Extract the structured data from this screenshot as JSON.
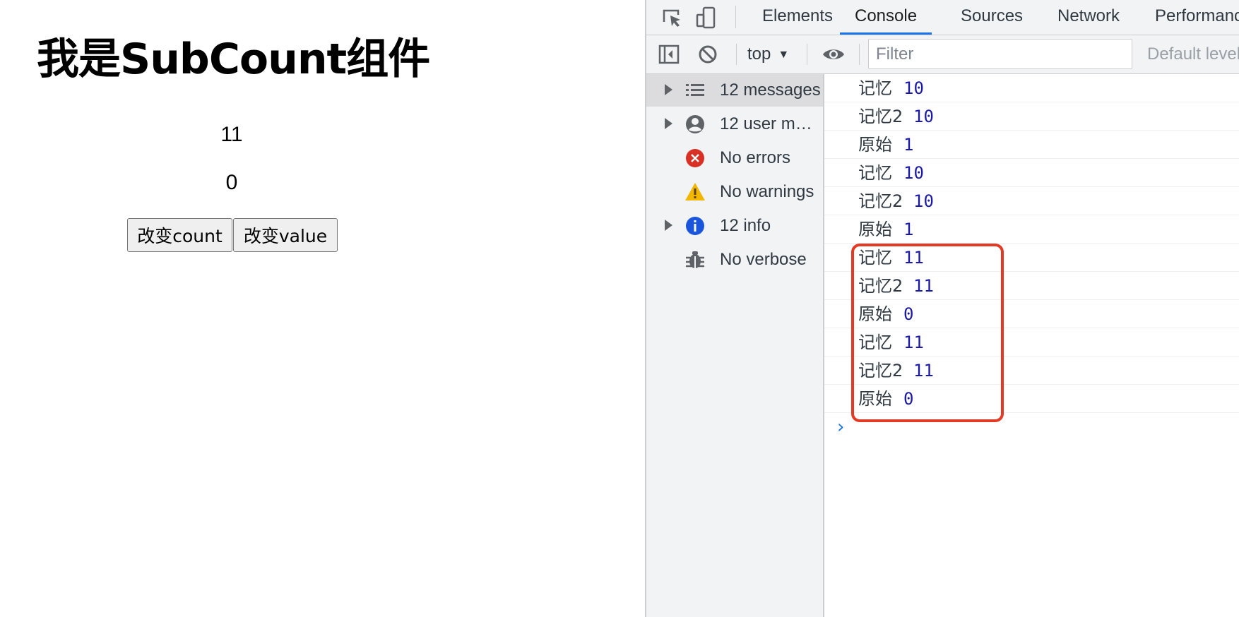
{
  "page": {
    "title": "我是SubCount组件",
    "count": "11",
    "value": "0",
    "buttons": {
      "change_count": "改变count",
      "change_value": "改变value"
    }
  },
  "devtools": {
    "tabs": [
      "Elements",
      "Console",
      "Sources",
      "Network",
      "Performanc"
    ],
    "active_tab": "Console",
    "toolbar": {
      "context": "top",
      "filter_placeholder": "Filter",
      "levels": "Default levels"
    },
    "sidebar": [
      {
        "label": "12 messages",
        "icon": "list-icon",
        "expandable": true,
        "selected": true
      },
      {
        "label": "12 user me…",
        "icon": "user-icon",
        "expandable": true,
        "selected": false
      },
      {
        "label": "No errors",
        "icon": "error-icon",
        "expandable": false,
        "selected": false
      },
      {
        "label": "No warnings",
        "icon": "warning-icon",
        "expandable": false,
        "selected": false
      },
      {
        "label": "12 info",
        "icon": "info-icon",
        "expandable": true,
        "selected": false
      },
      {
        "label": "No verbose",
        "icon": "bug-icon",
        "expandable": false,
        "selected": false
      }
    ],
    "messages": [
      {
        "label": "记忆",
        "value": "10"
      },
      {
        "label": "记忆2",
        "value": "10"
      },
      {
        "label": "原始",
        "value": "1"
      },
      {
        "label": "记忆",
        "value": "10"
      },
      {
        "label": "记忆2",
        "value": "10"
      },
      {
        "label": "原始",
        "value": "1"
      },
      {
        "label": "记忆",
        "value": "11"
      },
      {
        "label": "记忆2",
        "value": "11"
      },
      {
        "label": "原始",
        "value": "0"
      },
      {
        "label": "记忆",
        "value": "11"
      },
      {
        "label": "记忆2",
        "value": "11"
      },
      {
        "label": "原始",
        "value": "0"
      }
    ],
    "prompt": "›",
    "colors": {
      "accent": "#1a73e8",
      "highlight_border": "#e33a25",
      "number": "#1a1aa6",
      "error": "#d93025",
      "warning": "#f2b600",
      "info": "#1a56db"
    }
  }
}
